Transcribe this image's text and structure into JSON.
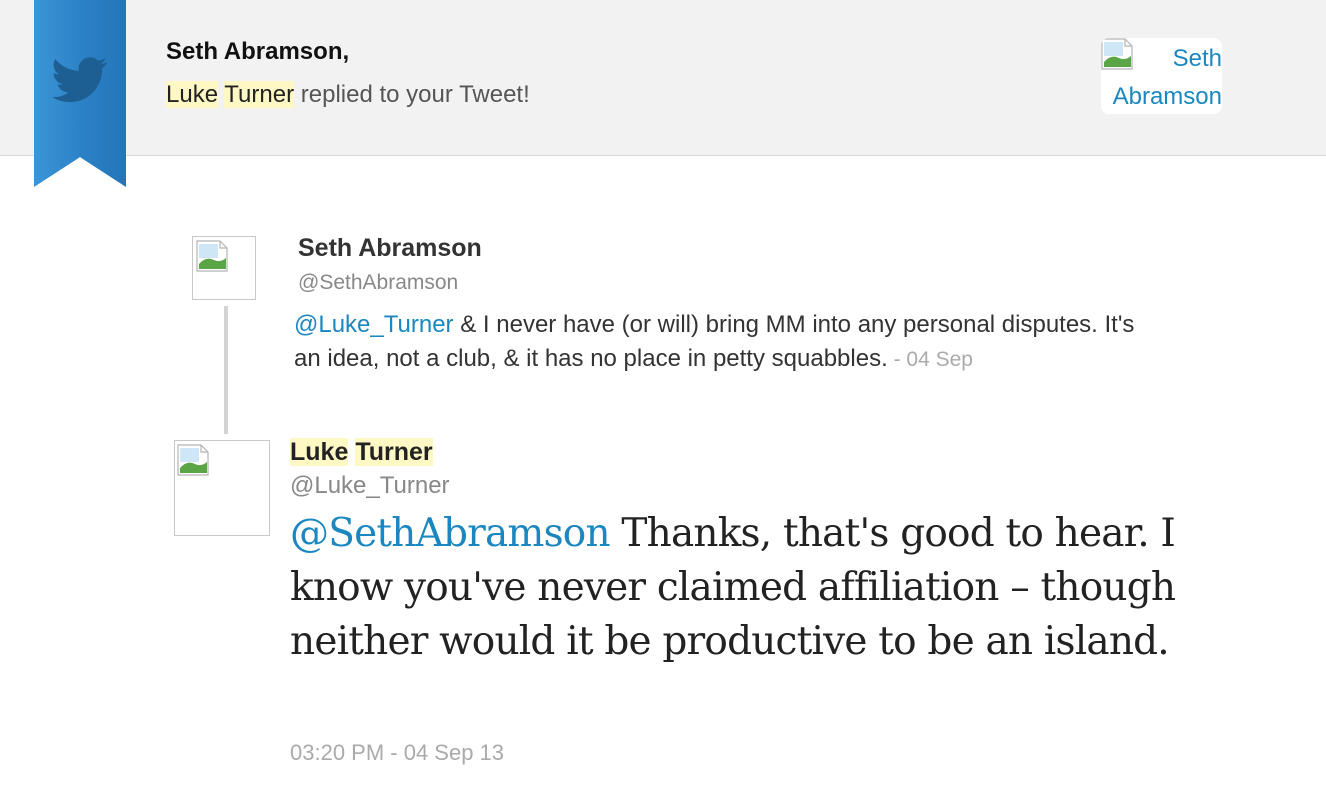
{
  "header": {
    "greeting": "Seth Abramson,",
    "notification": {
      "first_name": "Luke",
      "last_name": "Turner",
      "action": "replied to your Tweet!"
    },
    "avatar_link": {
      "line1": "Seth",
      "line2": "Abramson"
    },
    "brand_icon": "twitter-bird-icon",
    "ribbon_color": "#2a7fc4"
  },
  "original_tweet": {
    "name": "Seth Abramson",
    "handle": "@SethAbramson",
    "mention": "@Luke_Turner",
    "text": " & I never have (or will) bring MM into any personal disputes. It's an idea, not a club, & it has no place in petty squabbles.",
    "date": " - 04 Sep"
  },
  "reply_tweet": {
    "first_name": "Luke",
    "last_name": "Turner",
    "handle": "@Luke_Turner",
    "mention": "@SethAbramson",
    "text": " Thanks, that's good to hear. I know you've never claimed affiliation – though neither would it be productive to be an island.",
    "timestamp": "03:20 PM - 04 Sep 13"
  },
  "colors": {
    "link": "#1a87c0",
    "highlight": "#fff8c4",
    "header_bg": "#f2f2f2"
  }
}
